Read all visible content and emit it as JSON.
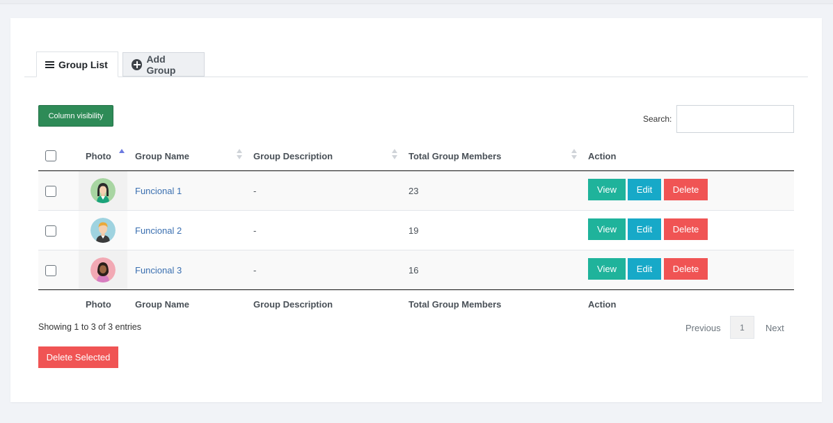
{
  "tabs": {
    "group_list": "Group List",
    "add_group": "Add Group"
  },
  "toolbar": {
    "column_visibility": "Column visibility",
    "search_label": "Search:",
    "search_value": ""
  },
  "table": {
    "columns": {
      "photo": "Photo",
      "group_name": "Group Name",
      "group_description": "Group Description",
      "total_group_members": "Total Group Members",
      "action": "Action"
    },
    "sorted_column": "Photo",
    "sort_direction": "ascending",
    "rows": [
      {
        "photo": "female-avatar-icon",
        "name": "Funcional 1",
        "description": "-",
        "members": "23",
        "checked": false
      },
      {
        "photo": "male-avatar-icon",
        "name": "Funcional 2",
        "description": "-",
        "members": "19",
        "checked": false
      },
      {
        "photo": "female-avatar-icon",
        "name": "Funcional 3",
        "description": "-",
        "members": "16",
        "checked": false
      }
    ],
    "actions": {
      "view": "View",
      "edit": "Edit",
      "delete": "Delete"
    }
  },
  "footer": {
    "info": "Showing 1 to 3 of 3 entries",
    "previous": "Previous",
    "page": "1",
    "next": "Next",
    "delete_selected": "Delete Selected"
  },
  "colors": {
    "page_bg": "#f1f3f7",
    "column_visibility": "#2e8b57",
    "view": "#1fb39b",
    "edit": "#17a9c8",
    "delete": "#f05454",
    "link": "#3a6fb0",
    "sort_active": "#6c7ae0"
  }
}
